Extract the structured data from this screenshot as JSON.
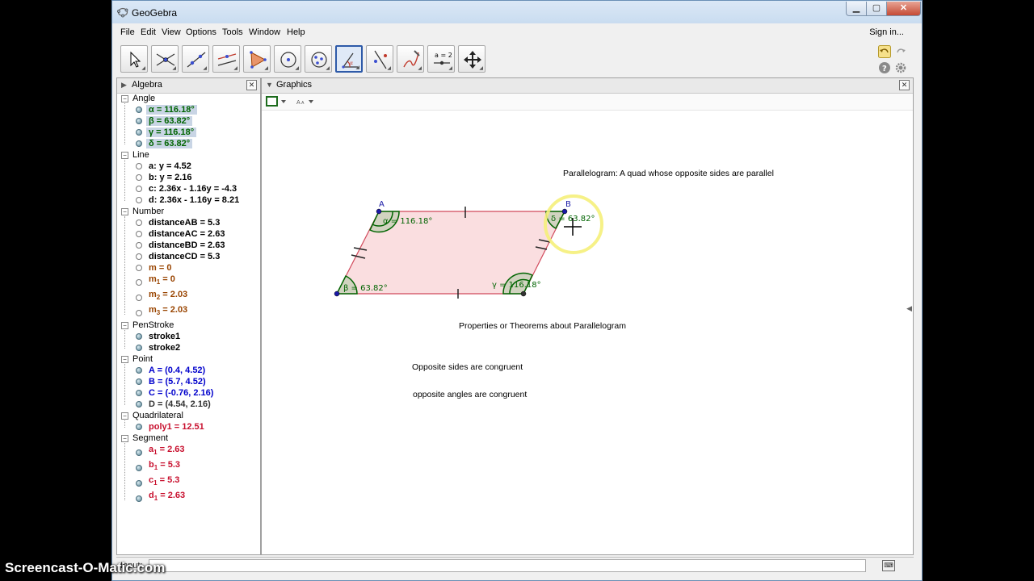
{
  "window": {
    "title": "GeoGebra"
  },
  "menu": {
    "items": [
      "File",
      "Edit",
      "View",
      "Options",
      "Tools",
      "Window",
      "Help"
    ],
    "sign_in": "Sign in..."
  },
  "toolbar": {
    "tools": [
      "move-tool",
      "point-tool",
      "line-tool",
      "perpendicular-line-tool",
      "polygon-tool",
      "circle-tool",
      "conic-tool",
      "angle-tool",
      "reflect-tool",
      "freehand-tool",
      "slider-tool",
      "move-graphics-view-tool"
    ],
    "selected": "angle-tool",
    "slider_label": "a = 2"
  },
  "algebra": {
    "title": "Algebra",
    "categories": [
      {
        "label": "Angle",
        "items": [
          {
            "text": "α = 116.18°",
            "color": "green",
            "shown": true,
            "highlight": true
          },
          {
            "text": "β = 63.82°",
            "color": "green",
            "shown": true,
            "highlight": true
          },
          {
            "text": "γ = 116.18°",
            "color": "green",
            "shown": true,
            "highlight": true
          },
          {
            "text": "δ = 63.82°",
            "color": "green",
            "shown": true,
            "highlight": true
          }
        ]
      },
      {
        "label": "Line",
        "items": [
          {
            "text": "a: y = 4.52",
            "color": "black",
            "shown": false
          },
          {
            "text": "b: y = 2.16",
            "color": "black",
            "shown": false
          },
          {
            "text": "c: 2.36x - 1.16y = -4.3",
            "color": "black",
            "shown": false
          },
          {
            "text": "d: 2.36x - 1.16y = 8.21",
            "color": "black",
            "shown": false
          }
        ]
      },
      {
        "label": "Number",
        "items": [
          {
            "text": "distanceAB = 5.3",
            "color": "black",
            "shown": false
          },
          {
            "text": "distanceAC = 2.63",
            "color": "black",
            "shown": false
          },
          {
            "text": "distanceBD = 2.63",
            "color": "black",
            "shown": false
          },
          {
            "text": "distanceCD = 5.3",
            "color": "black",
            "shown": false
          },
          {
            "text": "m = 0",
            "color": "brown",
            "shown": false
          },
          {
            "name": "m",
            "sub": "1",
            "value": " = 0",
            "color": "brown",
            "shown": false
          },
          {
            "name": "m",
            "sub": "2",
            "value": " = 2.03",
            "color": "brown",
            "shown": false
          },
          {
            "name": "m",
            "sub": "3",
            "value": " = 2.03",
            "color": "brown",
            "shown": false
          }
        ]
      },
      {
        "label": "PenStroke",
        "items": [
          {
            "text": "stroke1",
            "color": "black",
            "shown": true
          },
          {
            "text": "stroke2",
            "color": "black",
            "shown": true
          }
        ]
      },
      {
        "label": "Point",
        "items": [
          {
            "text": "A = (0.4, 4.52)",
            "color": "blue",
            "shown": true
          },
          {
            "text": "B = (5.7, 4.52)",
            "color": "blue",
            "shown": true
          },
          {
            "text": "C = (-0.76, 2.16)",
            "color": "blue",
            "shown": true
          },
          {
            "text": "D = (4.54, 2.16)",
            "color": "dark",
            "shown": true
          }
        ]
      },
      {
        "label": "Quadrilateral",
        "items": [
          {
            "text": "poly1 = 12.51",
            "color": "red",
            "shown": true
          }
        ]
      },
      {
        "label": "Segment",
        "items": [
          {
            "name": "a",
            "sub": "1",
            "value": " = 2.63",
            "color": "red",
            "shown": true
          },
          {
            "name": "b",
            "sub": "1",
            "value": " = 5.3",
            "color": "red",
            "shown": true
          },
          {
            "name": "c",
            "sub": "1",
            "value": " = 5.3",
            "color": "red",
            "shown": true
          },
          {
            "name": "d",
            "sub": "1",
            "value": " = 2.63",
            "color": "red",
            "shown": true
          }
        ]
      }
    ]
  },
  "graphics": {
    "title": "Graphics",
    "texts": {
      "definition": "Parallelogram:  A quad whose opposite sides are parallel",
      "properties_heading": "Properties or Theorems about Parallelogram",
      "property_1": "Opposite sides are congruent",
      "property_2": "opposite angles are congruent"
    },
    "points": {
      "A": "A",
      "B": "B"
    },
    "angle_labels": {
      "alpha": "α = 116.18°",
      "beta": "β = 63.82°",
      "gamma": "γ = 116.18°",
      "delta": "δ = 63.82°"
    }
  },
  "input_bar": {
    "label": "Input:",
    "value": ""
  },
  "colors": {
    "angle": "#006400",
    "polygon_fill": "#f9d6d8",
    "polygon_edge": "#d1495b",
    "point_blue": "#1a1aa6",
    "highlight_circle": "#f5f07a"
  },
  "watermark": "Screencast-O-Matic.com"
}
